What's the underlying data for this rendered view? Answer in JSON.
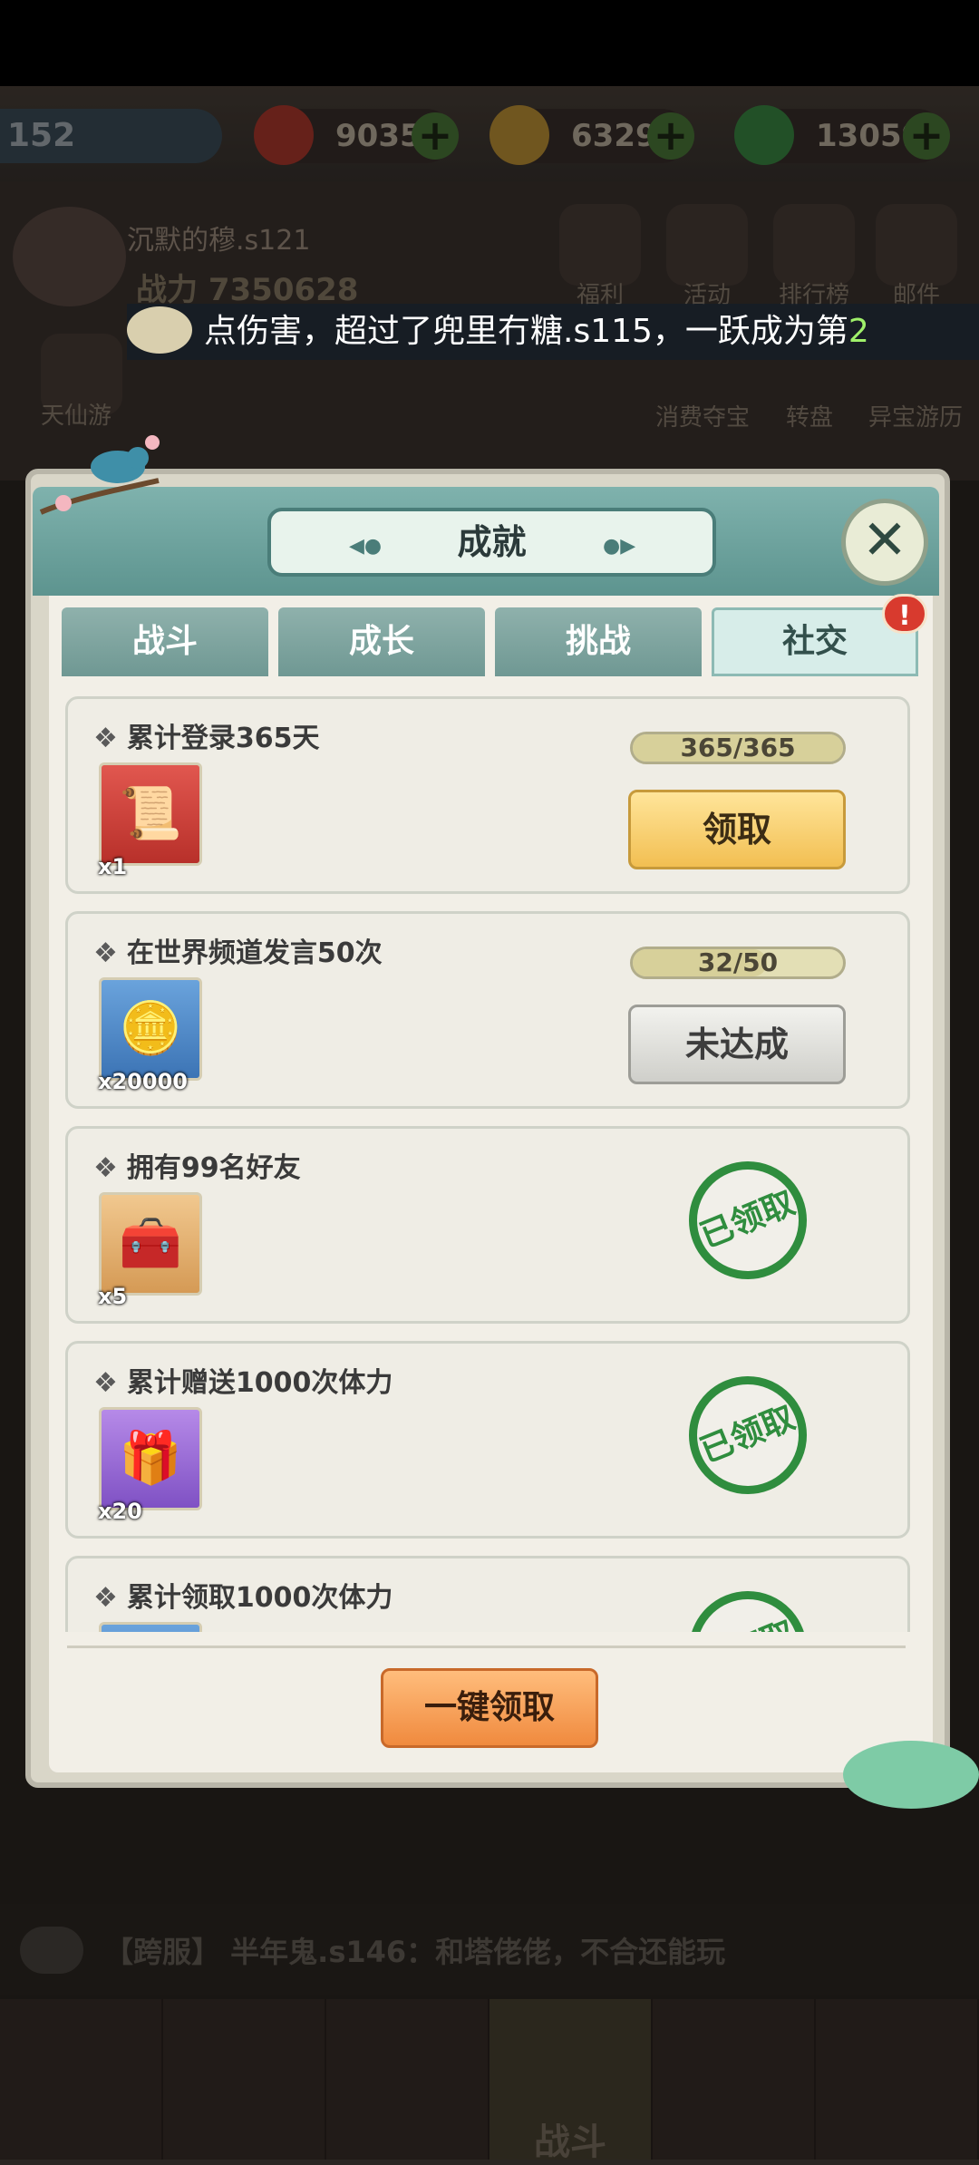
{
  "hud": {
    "level": "152",
    "resources": [
      {
        "icon": "peach-icon",
        "value": "9035/3",
        "color": "#c03a2e"
      },
      {
        "icon": "gold-coin-icon",
        "value": "6329W",
        "color": "#d9a43a"
      },
      {
        "icon": "jade-icon",
        "value": "13059",
        "color": "#3d9a4a"
      }
    ],
    "player_name": "沉默的穆.s121",
    "power_label": "战力",
    "power_value": "7350628",
    "top_menu": [
      "福利",
      "活动",
      "排行榜",
      "邮件"
    ],
    "sub_menu": [
      "天仙游",
      "消费夺宝",
      "转盘",
      "异宝游历"
    ],
    "ticker_text": "点伤害，超过了兜里冇糖.s115，一跃成为第",
    "ticker_highlight": "2"
  },
  "modal": {
    "title": "成就",
    "tabs": [
      "战斗",
      "成长",
      "挑战",
      "社交"
    ],
    "active_tab": 3,
    "tab_badge": "!",
    "achievements": [
      {
        "title": "累计登录365天",
        "reward_icon": "gold-scroll-icon",
        "reward_qty": "x1",
        "progress": "365/365",
        "progress_fraction": 1.0,
        "status": "claimable",
        "button_label": "领取"
      },
      {
        "title": "在世界频道发言50次",
        "reward_icon": "paw-coin-icon",
        "reward_qty": "x20000",
        "progress": "32/50",
        "progress_fraction": 0.64,
        "status": "incomplete",
        "button_label": "未达成"
      },
      {
        "title": "拥有99名好友",
        "reward_icon": "gift-crate-icon",
        "reward_qty": "x5",
        "status": "claimed",
        "stamp_label": "已领取"
      },
      {
        "title": "累计赠送1000次体力",
        "reward_icon": "purple-gift-box-icon",
        "reward_qty": "x20",
        "status": "claimed",
        "stamp_label": "已领取"
      },
      {
        "title": "累计领取1000次体力",
        "reward_icon": "blue-item-icon",
        "reward_qty": "",
        "status": "claimed",
        "stamp_label": "已领取"
      }
    ],
    "one_key_button": "一键领取"
  },
  "chat": {
    "channel": "【跨服】",
    "speaker": "半年鬼.s146",
    "message": "：和塔佬佬，不合还能玩"
  },
  "bottom_nav": {
    "active_label": "战斗"
  }
}
